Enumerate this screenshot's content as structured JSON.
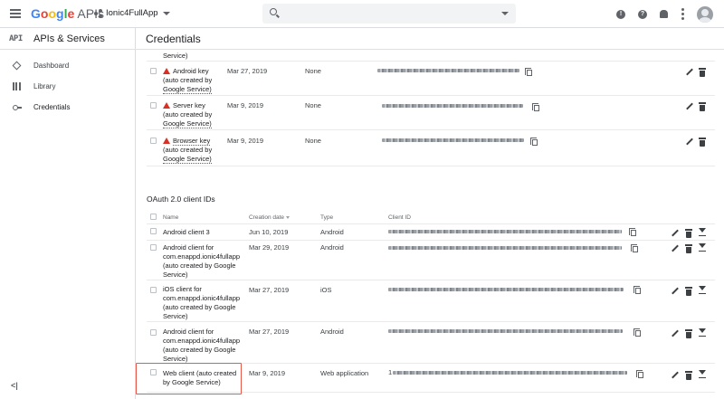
{
  "header": {
    "logo_google": "Google",
    "logo_apis": "APIs",
    "project_name": "Ionic4FullApp",
    "search_placeholder": ""
  },
  "sidebar": {
    "badge": "API",
    "title": "APIs & Services",
    "items": [
      {
        "label": "Dashboard",
        "icon": "dashboard-icon"
      },
      {
        "label": "Library",
        "icon": "library-icon"
      },
      {
        "label": "Credentials",
        "icon": "key-icon",
        "active": true
      }
    ],
    "collapse": "<|"
  },
  "page": {
    "title": "Credentials"
  },
  "api_keys": {
    "top_fragment": "Service)",
    "rows": [
      {
        "name": "Android key",
        "note1": "(auto created by",
        "note2": "Google Service)",
        "date": "Mar 27, 2019",
        "restriction": "None"
      },
      {
        "name": "Server key",
        "note1": "(auto created by",
        "note2": "Google Service)",
        "date": "Mar 9, 2019",
        "restriction": "None"
      },
      {
        "name": "Browser key",
        "note1": "(auto created by",
        "note2": "Google Service)",
        "date": "Mar 9, 2019",
        "restriction": "None"
      }
    ]
  },
  "oauth": {
    "title": "OAuth 2.0 client IDs",
    "columns": {
      "name": "Name",
      "date": "Creation date",
      "type": "Type",
      "client_id": "Client ID"
    },
    "rows": [
      {
        "lines": [
          "Android client 3"
        ],
        "date": "Jun 10, 2019",
        "type": "Android"
      },
      {
        "lines": [
          "Android client for",
          "com.enappd.ionic4fullapp",
          "(auto created by Google",
          "Service)"
        ],
        "date": "Mar 29, 2019",
        "type": "Android"
      },
      {
        "lines": [
          "iOS client for",
          "com.enappd.ionic4fullapp",
          "(auto created by Google",
          "Service)"
        ],
        "date": "Mar 27, 2019",
        "type": "iOS"
      },
      {
        "lines": [
          "Android client for",
          "com.enappd.ionic4fullapp",
          "(auto created by Google",
          "Service)"
        ],
        "date": "Mar 27, 2019",
        "type": "Android"
      },
      {
        "lines": [
          "Web client (auto created",
          "by Google Service)"
        ],
        "date": "Mar 9, 2019",
        "type": "Web application",
        "client_prefix": "1"
      }
    ]
  },
  "colors": {
    "accent": "#1a73e8",
    "warning": "#d93025",
    "highlight_box": "#e8584b"
  }
}
